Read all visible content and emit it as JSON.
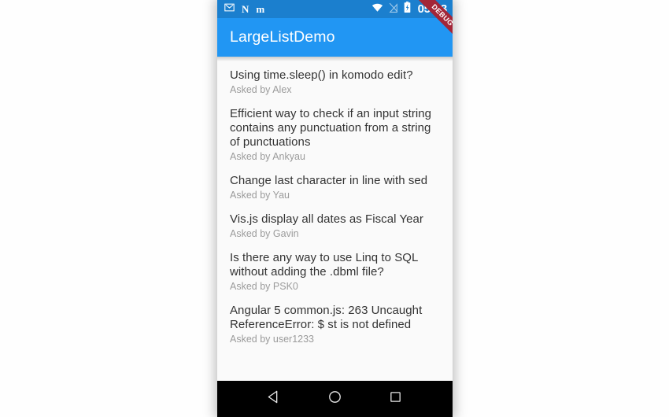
{
  "statusbar": {
    "notifications": [
      {
        "name": "gmail-icon",
        "glyph": "✉"
      },
      {
        "name": "notification-n-icon",
        "glyph": "N"
      },
      {
        "name": "notification-m-icon",
        "glyph": "m"
      }
    ],
    "wifi": "wifi-icon",
    "cellular": "no-sim-icon",
    "battery": "battery-charging-icon",
    "clock": "05:23"
  },
  "appbar": {
    "title": "LargeListDemo",
    "background": "#2196f3",
    "statusbar_background": "#1b7fce"
  },
  "ribbon": {
    "label": "DEBUG",
    "color": "#a32638"
  },
  "list": {
    "items": [
      {
        "title": "Using time.sleep() in komodo edit?",
        "subtitle": "Asked by Alex"
      },
      {
        "title": "Efficient way to check if an input string contains any punctuation from a string of punctuations",
        "subtitle": "Asked by Ankyau"
      },
      {
        "title": "Change last character in line with sed",
        "subtitle": "Asked by Yau"
      },
      {
        "title": "Vis.js display all dates as Fiscal Year",
        "subtitle": "Asked by Gavin"
      },
      {
        "title": "Is there any way to use Linq to SQL without adding the .dbml file?",
        "subtitle": "Asked by PSK0"
      },
      {
        "title": "Angular 5 common.js: 263 Uncaught ReferenceError: $ st is not defined",
        "subtitle": "Asked by user1233"
      }
    ]
  },
  "navbar": {
    "back": "back-icon",
    "home": "home-icon",
    "recents": "recents-icon"
  }
}
